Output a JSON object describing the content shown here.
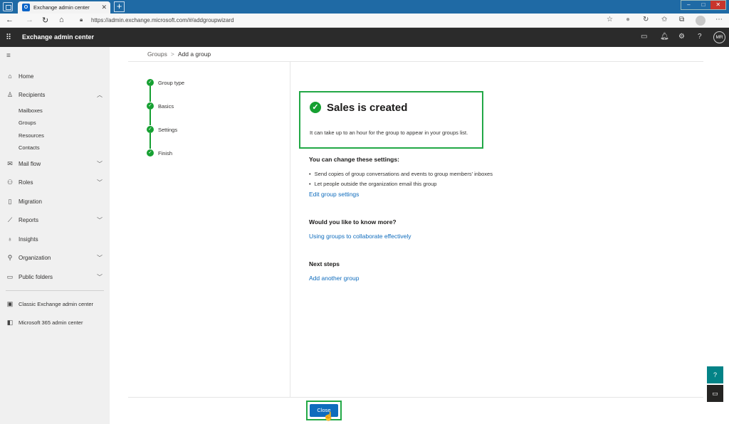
{
  "browser": {
    "tab_title": "Exchange admin center",
    "tab_favicon": "O",
    "url": "https://admin.exchange.microsoft.com/#/addgroupwizard"
  },
  "app": {
    "title": "Exchange admin center",
    "user_initials": "MR"
  },
  "sidebar": {
    "items": [
      {
        "id": "home",
        "label": "Home",
        "icon": "home-icon"
      },
      {
        "id": "recipients",
        "label": "Recipients",
        "icon": "person-icon"
      },
      {
        "id": "mail-flow",
        "label": "Mail flow",
        "icon": "mail-icon"
      },
      {
        "id": "roles",
        "label": "Roles",
        "icon": "roles-icon"
      },
      {
        "id": "migration",
        "label": "Migration",
        "icon": "migration-icon"
      },
      {
        "id": "reports",
        "label": "Reports",
        "icon": "chart-icon"
      },
      {
        "id": "insights",
        "label": "Insights",
        "icon": "lightbulb-icon"
      },
      {
        "id": "organization",
        "label": "Organization",
        "icon": "org-icon"
      },
      {
        "id": "public-folders",
        "label": "Public folders",
        "icon": "folder-icon"
      }
    ],
    "recipients_sub": [
      "Mailboxes",
      "Groups",
      "Resources",
      "Contacts"
    ],
    "bottom": [
      {
        "label": "Classic Exchange admin center",
        "icon": "exchange-icon"
      },
      {
        "label": "Microsoft 365 admin center",
        "icon": "office-icon"
      }
    ]
  },
  "breadcrumb": {
    "parent": "Groups",
    "separator": ">",
    "current": "Add a group"
  },
  "steps": [
    "Group type",
    "Basics",
    "Settings",
    "Finish"
  ],
  "success": {
    "title": "Sales is created",
    "description": "It can take up to an hour for the group to appear in your groups list."
  },
  "settings_section": {
    "heading": "You can change these settings:",
    "bullets": [
      "Send copies of group conversations and events to group members' inboxes",
      "Let people outside the organization email this group"
    ],
    "link": "Edit group settings"
  },
  "know_more": {
    "heading": "Would you like to know more?",
    "link": "Using groups to collaborate effectively"
  },
  "next_steps": {
    "heading": "Next steps",
    "link": "Add another group"
  },
  "footer": {
    "close_label": "Close"
  },
  "colors": {
    "accent": "#0f6cbd",
    "success": "#16a032",
    "highlight": "#22a846",
    "header_bg": "#2b2b2b",
    "browser_bar": "#1f6aa5"
  }
}
